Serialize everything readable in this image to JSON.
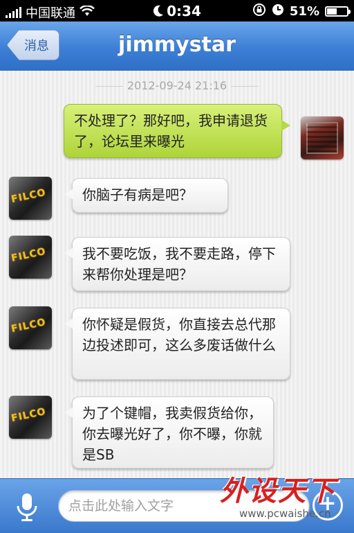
{
  "status_bar": {
    "carrier": "中国联通",
    "time": "0:34",
    "battery_percent": "51%",
    "battery_level": 0.51
  },
  "nav": {
    "back_label": "消息",
    "title": "jimmystar"
  },
  "chat": {
    "timestamp": "2012-09-24 21:16",
    "messages": [
      {
        "side": "outgoing",
        "text": "不处理了？那好吧，我申请退货了，论坛里来曝光",
        "avatar_icon": "motherboard-avatar-icon"
      },
      {
        "side": "incoming",
        "text": "你脑子有病是吧？",
        "avatar_icon": "filco-avatar-icon"
      },
      {
        "side": "incoming",
        "text": "我不要吃饭，我不要走路，停下来帮你处理是吧？",
        "avatar_icon": "filco-avatar-icon"
      },
      {
        "side": "incoming",
        "text": "你怀疑是假货，你直接去总代那边投述即可，这么多废话做什么",
        "avatar_icon": "filco-avatar-icon"
      },
      {
        "side": "incoming",
        "text": "为了个键帽，我卖假货给你，你去曝光好了，你不曝，你就是SB",
        "avatar_icon": "filco-avatar-icon"
      }
    ]
  },
  "avatar_logo_text": "FILCO",
  "input_bar": {
    "placeholder": "点击此处输入文字",
    "mic_icon": "microphone-icon",
    "plus_icon": "plus-icon"
  },
  "watermark": {
    "main": "外设天下",
    "sub": "www.pcwaishe.cn"
  },
  "colors": {
    "nav_blue": "#3d7fd6",
    "outgoing_bubble": "#b6d944",
    "incoming_bubble": "#ffffff"
  }
}
